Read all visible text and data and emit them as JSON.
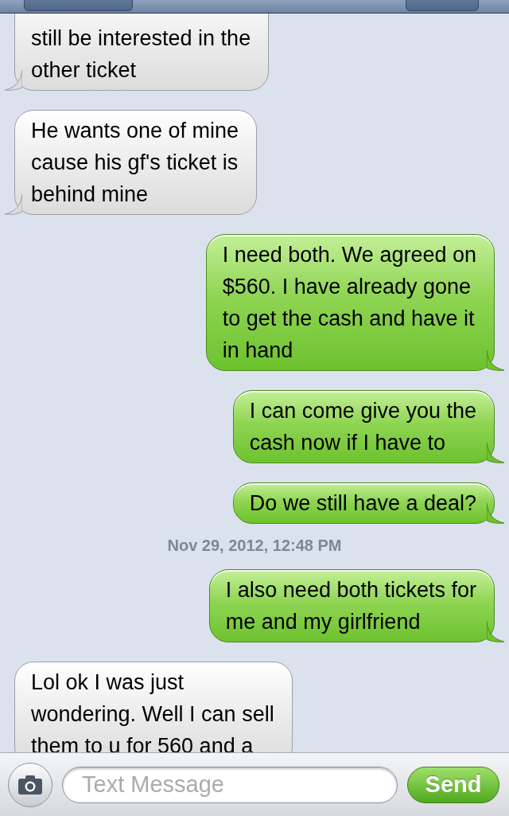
{
  "messages": [
    {
      "kind": "received",
      "text": "still be interested in the\nother ticket"
    },
    {
      "kind": "received",
      "text": "He wants one of mine\ncause his gf's ticket is\nbehind mine"
    },
    {
      "kind": "sent",
      "text": "I need both. We agreed on\n$560. I have already gone\nto get the cash and have it\nin hand"
    },
    {
      "kind": "sent",
      "text": "I can come give you the\ncash now if I have to"
    },
    {
      "kind": "sent",
      "text": "Do we still have a deal?"
    },
    {
      "kind": "timestamp",
      "text": "Nov 29, 2012, 12:48 PM"
    },
    {
      "kind": "sent",
      "text": "I also need both tickets for\nme and my girlfriend"
    },
    {
      "kind": "received",
      "text": "Lol ok I was just\nwondering. Well I can sell\nthem to u for 560 and a"
    }
  ],
  "composer": {
    "placeholder": "Text Message",
    "send": "Send"
  }
}
